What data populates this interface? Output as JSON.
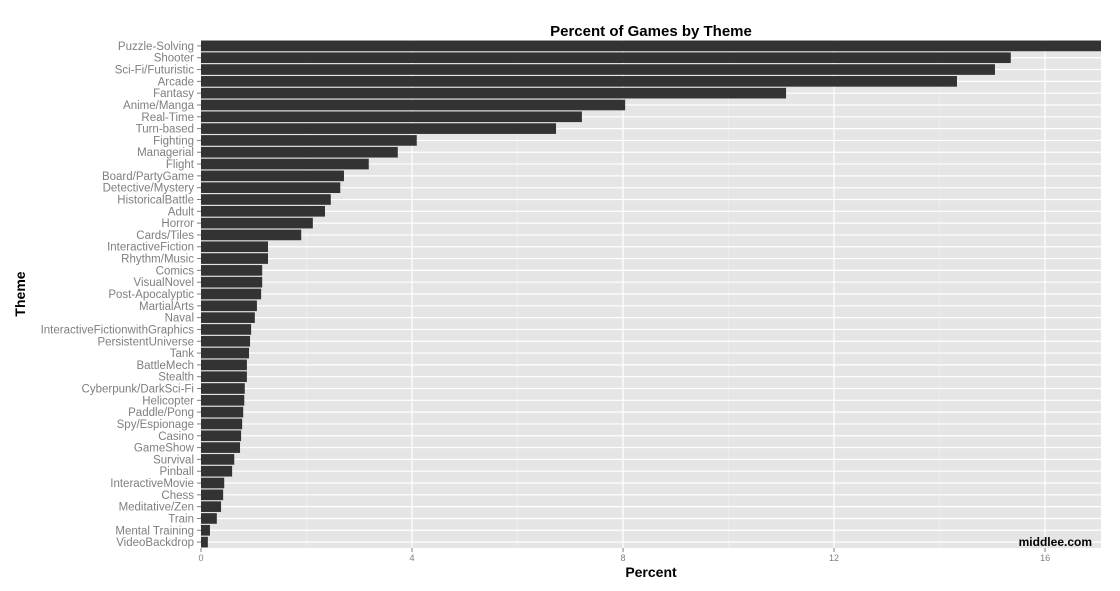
{
  "chart_data": {
    "type": "bar",
    "orientation": "horizontal",
    "title": "Percent of Games by Theme",
    "xlabel": "Percent",
    "ylabel": "Theme",
    "xlim": [
      0,
      17.06
    ],
    "xticks": [
      0,
      4,
      8,
      12,
      16
    ],
    "grid": true,
    "legend": "none",
    "annotation": "middlee.com",
    "bar_color": "#333333",
    "panel_color": "#E5E5E5",
    "categories": [
      "Puzzle-Solving",
      "Shooter",
      "Sci-Fi/Futuristic",
      "Arcade",
      "Fantasy",
      "Anime/Manga",
      "Real-Time",
      "Turn-based",
      "Fighting",
      "Managerial",
      "Flight",
      "Board/PartyGame",
      "Detective/Mystery",
      "HistoricalBattle",
      "Adult",
      "Horror",
      "Cards/Tiles",
      "InteractiveFiction",
      "Rhythm/Music",
      "Comics",
      "VisualNovel",
      "Post-Apocalyptic",
      "MartialArts",
      "Naval",
      "InteractiveFictionwithGraphics",
      "PersistentUniverse",
      "Tank",
      "BattleMech",
      "Stealth",
      "Cyberpunk/DarkSci-Fi",
      "Helicopter",
      "Paddle/Pong",
      "Spy/Espionage",
      "Casino",
      "GameShow",
      "Survival",
      "Pinball",
      "InteractiveMovie",
      "Chess",
      "Meditative/Zen",
      "Train",
      "Mental Training",
      "VideoBackdrop"
    ],
    "values": [
      17.06,
      15.35,
      15.05,
      14.33,
      11.09,
      8.04,
      7.22,
      6.73,
      4.09,
      3.73,
      3.18,
      2.71,
      2.64,
      2.46,
      2.35,
      2.12,
      1.9,
      1.27,
      1.27,
      1.16,
      1.16,
      1.14,
      1.06,
      1.02,
      0.95,
      0.93,
      0.91,
      0.87,
      0.87,
      0.83,
      0.82,
      0.8,
      0.78,
      0.76,
      0.74,
      0.63,
      0.59,
      0.44,
      0.42,
      0.38,
      0.3,
      0.17,
      0.13
    ]
  }
}
